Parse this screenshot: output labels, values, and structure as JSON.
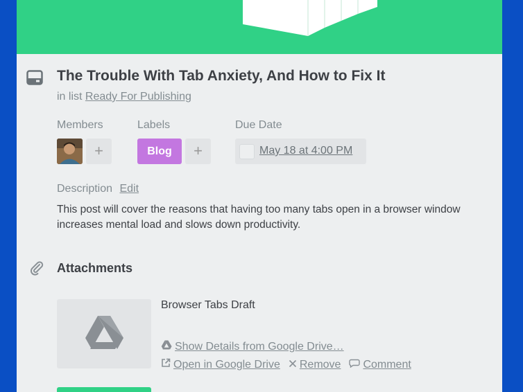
{
  "card": {
    "title": "The Trouble With Tab Anxiety, And How to Fix It",
    "list_prefix": "in list",
    "list_name": "Ready For Publishing"
  },
  "members": {
    "label": "Members",
    "add": "+"
  },
  "labels": {
    "label": "Labels",
    "items": [
      {
        "name": "Blog",
        "color": "#c377e0"
      }
    ],
    "add": "+"
  },
  "due_date": {
    "label": "Due Date",
    "value": "May 18 at 4:00 PM"
  },
  "description": {
    "label": "Description",
    "edit": "Edit",
    "text": "This post will cover the reasons that having too many tabs open in a browser window increases mental load and slows down productivity."
  },
  "attachments": {
    "title": "Attachments",
    "items": [
      {
        "name": "Browser Tabs Draft",
        "details_link": "Show Details from Google Drive…",
        "open_link": "Open in Google Drive",
        "remove": "Remove",
        "comment": "Comment"
      }
    ]
  },
  "colors": {
    "cover": "#30d186",
    "background": "#0a4fc4",
    "label_blog": "#c377e0"
  },
  "icons": [
    "card-icon",
    "paperclip-icon",
    "google-drive-icon",
    "external-link-icon",
    "close-icon",
    "comment-icon",
    "plus-icon"
  ]
}
